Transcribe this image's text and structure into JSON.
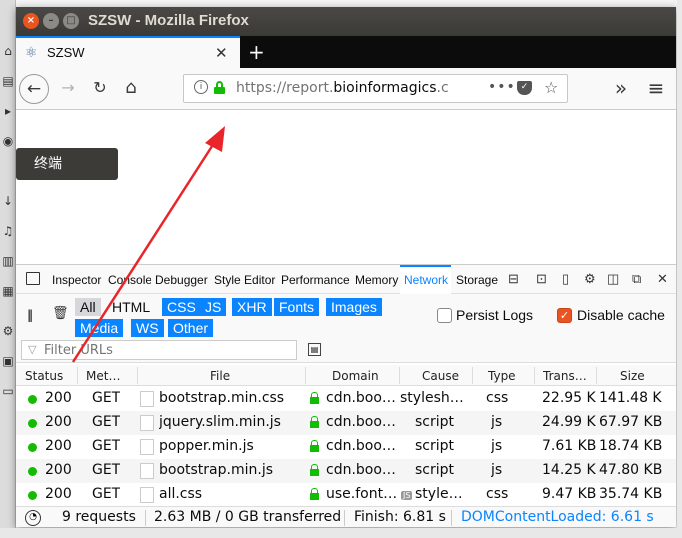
{
  "window": {
    "title": "SZSW - Mozilla Firefox",
    "close_glyph": "×",
    "min_glyph": "–",
    "max_glyph": "□"
  },
  "tab": {
    "title": "SZSW",
    "close_glyph": "✕",
    "new_tab_glyph": "+"
  },
  "urlbar": {
    "url_prefix": "https://report.",
    "url_domain": "bioinformagics",
    "url_suffix": ".c",
    "more_glyph": "•••",
    "star_glyph": "☆"
  },
  "nav": {
    "back_glyph": "←",
    "forward_glyph": "→",
    "reload_glyph": "↻",
    "home_glyph": "⌂",
    "overflow_glyph": "»",
    "menu_glyph": "≡"
  },
  "tooltip": {
    "label": "终端"
  },
  "devtools": {
    "tabs": [
      {
        "label": "Inspector",
        "active": false
      },
      {
        "label": "Console",
        "active": false
      },
      {
        "label": "Debugger",
        "active": false
      },
      {
        "label": "Style Editor",
        "active": false
      },
      {
        "label": "Performance",
        "active": false
      },
      {
        "label": "Memory",
        "active": false
      },
      {
        "label": "Network",
        "active": true
      },
      {
        "label": "Storage",
        "active": false
      }
    ],
    "close_glyph": "✕",
    "filter_types": [
      {
        "label": "All",
        "state": "all"
      },
      {
        "label": "HTML",
        "state": "off"
      },
      {
        "label": "CSS",
        "state": "on"
      },
      {
        "label": "JS",
        "state": "on"
      },
      {
        "label": "XHR",
        "state": "on"
      },
      {
        "label": "Fonts",
        "state": "on"
      },
      {
        "label": "Images",
        "state": "on"
      },
      {
        "label": "Media",
        "state": "on"
      },
      {
        "label": "WS",
        "state": "on"
      },
      {
        "label": "Other",
        "state": "on"
      }
    ],
    "persist_logs": {
      "label": "Persist Logs",
      "checked": false
    },
    "disable_cache": {
      "label": "Disable cache",
      "checked": true
    },
    "filter_placeholder": "Filter URLs",
    "columns": [
      "Status",
      "Met…",
      "File",
      "Domain",
      "Cause",
      "Type",
      "Trans…",
      "Size"
    ],
    "requests": [
      {
        "status": "200",
        "method": "GET",
        "file": "bootstrap.min.css",
        "domain": "cdn.boo…",
        "cause": "stylesh…",
        "type": "css",
        "transferred": "22.95 KB",
        "size": "141.48 KB",
        "js_badge": ""
      },
      {
        "status": "200",
        "method": "GET",
        "file": "jquery.slim.min.js",
        "domain": "cdn.boo…",
        "cause": "script",
        "type": "js",
        "transferred": "24.99 KB",
        "size": "67.97 KB",
        "js_badge": ""
      },
      {
        "status": "200",
        "method": "GET",
        "file": "popper.min.js",
        "domain": "cdn.boo…",
        "cause": "script",
        "type": "js",
        "transferred": "7.61 KB",
        "size": "18.74 KB",
        "js_badge": ""
      },
      {
        "status": "200",
        "method": "GET",
        "file": "bootstrap.min.js",
        "domain": "cdn.boo…",
        "cause": "script",
        "type": "js",
        "transferred": "14.25 KB",
        "size": "47.80 KB",
        "js_badge": ""
      },
      {
        "status": "200",
        "method": "GET",
        "file": "all.css",
        "domain": "use.font…",
        "cause": "style…",
        "type": "css",
        "transferred": "9.47 KB",
        "size": "35.74 KB",
        "js_badge": "JS"
      }
    ],
    "summary": {
      "requests": "9 requests",
      "transferred": "2.63 MB / 0 GB transferred",
      "finish": "Finish: 6.81 s",
      "dcl": "DOMContentLoaded: 6.61 s"
    }
  },
  "colors": {
    "accent": "#0a84ff",
    "ubuntu_orange": "#e95420",
    "secure_green": "#12bc00",
    "annotation_red": "#e8262a"
  }
}
